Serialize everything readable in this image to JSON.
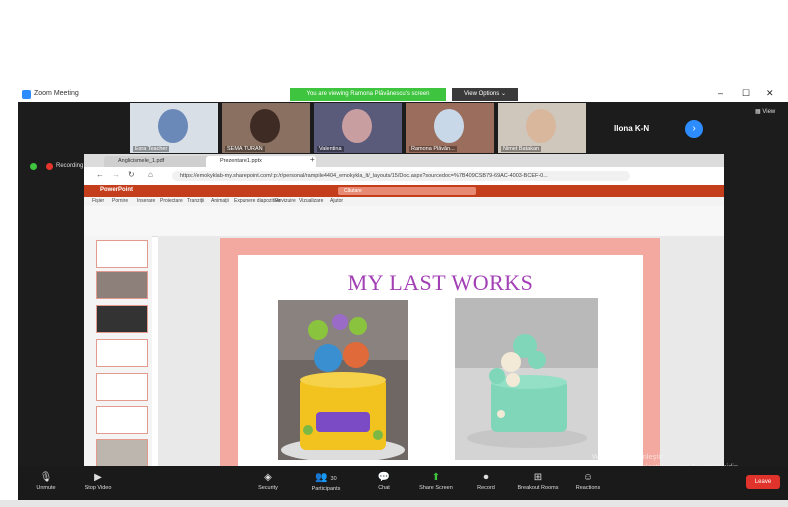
{
  "zoom": {
    "title": "Zoom Meeting",
    "viewing_banner": "You are viewing Ramona Plăvănescu's screen",
    "view_options": "View Options ⌄",
    "view_label": "View",
    "recording_label": "Recording",
    "next_icon": "chevron-right-icon"
  },
  "participants": [
    {
      "name": "Esra Teacher",
      "bg": "#d8dfe6",
      "face": "#6a88b8"
    },
    {
      "name": "SEMA TURAN",
      "bg": "#8a7060",
      "face": "#3d2b24"
    },
    {
      "name": "Valentina",
      "bg": "#5a5a7a",
      "face": "#c99ea0"
    },
    {
      "name": "Ramona Plăvăn...",
      "bg": "#9b6d5c",
      "face": "#c8d8e8"
    },
    {
      "name": "Nimet Batakan",
      "bg": "#cfc7bc",
      "face": "#d9b79d"
    }
  ],
  "featured_participant": "Ilona K-N",
  "browser": {
    "tab1": "Anglicismele_1.pdf",
    "tab2": "Prezentare1.pptx",
    "url": "https://emokyklab-my.sharepoint.com/:p:/r/personal/rampile4404_emokykla_lt/_layouts/15/Doc.aspx?sourcedoc=%7B409CSB79-69AC-4003-BCEF-0..."
  },
  "ppt": {
    "app_name": "PowerPoint",
    "search_placeholder": "Căutare",
    "menu": [
      "Fișier",
      "Pornire",
      "Inserare",
      "Proiectare",
      "Tranziții",
      "Animații",
      "Expunere diapozitive",
      "Revizuire",
      "Vizualizare",
      "Ajutor"
    ],
    "slide_title": "MY LAST WORKS",
    "title_color": "#a23fb5"
  },
  "watermark": {
    "line1": "Windows'u Etkinleştir",
    "line2": "Windows'u etkinleştirmek için Ayarlar'a gidin"
  },
  "controls": {
    "unmute": "Unmute",
    "stop_video": "Stop Video",
    "security": "Security",
    "participants": "Participants",
    "participants_count": "30",
    "chat": "Chat",
    "share_screen": "Share Screen",
    "record": "Record",
    "breakout_rooms": "Breakout Rooms",
    "reactions": "Reactions",
    "leave": "Leave"
  }
}
